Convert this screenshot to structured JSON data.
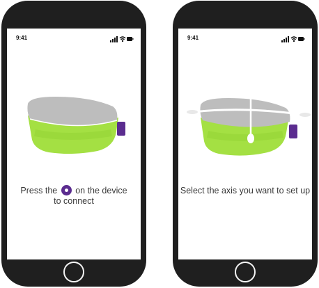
{
  "screens": [
    {
      "status": {
        "time": "9:41"
      },
      "caption": {
        "before": "Press the",
        "after": "on the device",
        "line2": "to connect"
      },
      "button_icon": "device-button-icon"
    },
    {
      "status": {
        "time": "9:41"
      },
      "caption": {
        "text": "Select the axis you want to set up"
      }
    }
  ],
  "colors": {
    "phone_body": "#1f1f1f",
    "device_shell": "#bdbdbd",
    "device_base": "#a4e043",
    "device_button": "#5b2c8f",
    "text": "#3a3a3a"
  }
}
